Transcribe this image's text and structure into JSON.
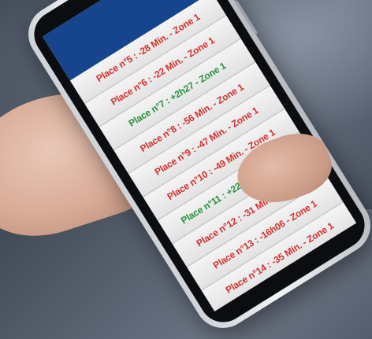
{
  "colors": {
    "late": "#d3312b",
    "early": "#27913b",
    "header": "#16458e"
  },
  "rows": [
    {
      "text": "Place n°5 : -28 Min. - Zone 1",
      "status": "late"
    },
    {
      "text": "Place n°6 : -22 Min. - Zone 1",
      "status": "late"
    },
    {
      "text": "Place n°7 : +2h27 - Zone 1",
      "status": "early"
    },
    {
      "text": "Place n°8 : -56 Min. - Zone 1",
      "status": "late"
    },
    {
      "text": "Place n°9 : -47 Min. - Zone 1",
      "status": "late"
    },
    {
      "text": "Place n°10 : -49 Min. - Zone 1",
      "status": "late"
    },
    {
      "text": "Place n°11 : +22 Min. - Zone 1",
      "status": "early"
    },
    {
      "text": "Place n°12 : -31 Min. - Zone 1",
      "status": "late"
    },
    {
      "text": "Place n°13 : -16h06 - Zone 1",
      "status": "late"
    },
    {
      "text": "Place n°14 : -35 Min. - Zone 1",
      "status": "late"
    }
  ]
}
